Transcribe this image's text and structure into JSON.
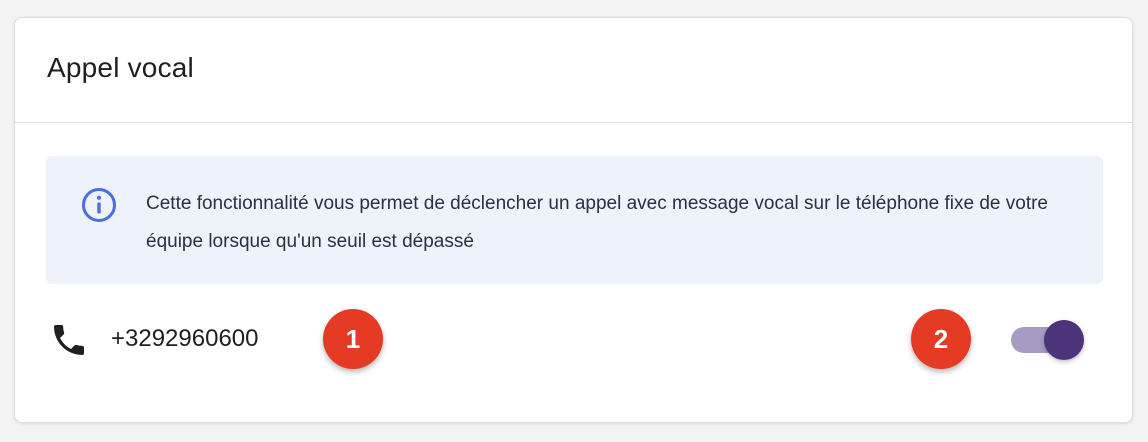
{
  "card": {
    "title": "Appel vocal"
  },
  "info": {
    "icon": "info-circle-icon",
    "text": "Cette fonctionnalité vous permet de déclencher un appel avec message vocal sur le téléphone fixe de votre équipe lorsque qu'un seuil est dépassé",
    "icon_color": "#4a6fe3",
    "background": "#eef2fb"
  },
  "phone": {
    "icon": "phone-icon",
    "number": "+3292960600"
  },
  "annotations": [
    {
      "label": "1",
      "color": "#e53a24"
    },
    {
      "label": "2",
      "color": "#e53a24"
    }
  ],
  "toggle": {
    "state": "on",
    "track_color": "#a89bc3",
    "knob_color": "#4b347a"
  }
}
